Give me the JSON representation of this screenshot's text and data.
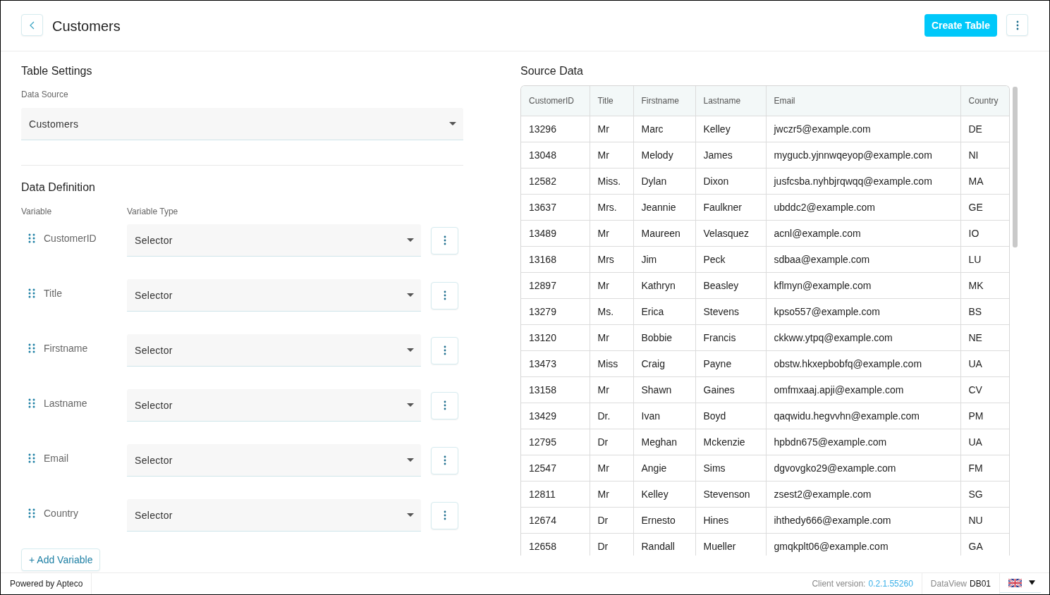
{
  "header": {
    "title": "Customers",
    "primary_action": "Create Table"
  },
  "table_settings": {
    "title": "Table Settings",
    "data_source": {
      "label": "Data Source",
      "value": "Customers"
    }
  },
  "data_definition": {
    "title": "Data Definition",
    "columns": [
      "Variable",
      "Variable Type"
    ],
    "variables": [
      {
        "name": "CustomerID",
        "type": "Selector"
      },
      {
        "name": "Title",
        "type": "Selector"
      },
      {
        "name": "Firstname",
        "type": "Selector"
      },
      {
        "name": "Lastname",
        "type": "Selector"
      },
      {
        "name": "Email",
        "type": "Selector"
      },
      {
        "name": "Country",
        "type": "Selector"
      }
    ],
    "add_button": "+ Add Variable"
  },
  "source_data": {
    "title": "Source Data",
    "columns": [
      "CustomerID",
      "Title",
      "Firstname",
      "Lastname",
      "Email",
      "Country"
    ],
    "rows": [
      [
        "13296",
        "Mr",
        "Marc",
        "Kelley",
        "jwczr5@example.com",
        "DE"
      ],
      [
        "13048",
        "Mr",
        "Melody",
        "James",
        "mygucb.yjnnwqeyop@example.com",
        "NI"
      ],
      [
        "12582",
        "Miss.",
        "Dylan",
        "Dixon",
        "jusfcsba.nyhbjrqwqq@example.com",
        "MA"
      ],
      [
        "13637",
        "Mrs.",
        "Jeannie",
        "Faulkner",
        "ubddc2@example.com",
        "GE"
      ],
      [
        "13489",
        "Mr",
        "Maureen",
        "Velasquez",
        "acnl@example.com",
        "IO"
      ],
      [
        "13168",
        "Mrs",
        "Jim",
        "Peck",
        "sdbaa@example.com",
        "LU"
      ],
      [
        "12897",
        "Mr",
        "Kathryn",
        "Beasley",
        "kflmyn@example.com",
        "MK"
      ],
      [
        "13279",
        "Ms.",
        "Erica",
        "Stevens",
        "kpso557@example.com",
        "BS"
      ],
      [
        "13120",
        "Mr",
        "Bobbie",
        "Francis",
        "ckkww.ytpq@example.com",
        "NE"
      ],
      [
        "13473",
        "Miss",
        "Craig",
        "Payne",
        "obstw.hkxepbobfq@example.com",
        "UA"
      ],
      [
        "13158",
        "Mr",
        "Shawn",
        "Gaines",
        "omfmxaaj.apji@example.com",
        "CV"
      ],
      [
        "13429",
        "Dr.",
        "Ivan",
        "Boyd",
        "qaqwidu.hegvvhn@example.com",
        "PM"
      ],
      [
        "12795",
        "Dr",
        "Meghan",
        "Mckenzie",
        "hpbdn675@example.com",
        "UA"
      ],
      [
        "12547",
        "Mr",
        "Angie",
        "Sims",
        "dgvovgko29@example.com",
        "FM"
      ],
      [
        "12811",
        "Mr",
        "Kelley",
        "Stevenson",
        "zsest2@example.com",
        "SG"
      ],
      [
        "12674",
        "Dr",
        "Ernesto",
        "Hines",
        "ihthedy666@example.com",
        "NU"
      ],
      [
        "12658",
        "Dr",
        "Randall",
        "Mueller",
        "gmqkplt06@example.com",
        "GA"
      ]
    ]
  },
  "footer": {
    "powered_by": "Powered by Apteco",
    "client_version": {
      "label": "Client version:",
      "value": "0.2.1.55260"
    },
    "dataview": {
      "label": "DataView",
      "value": "DB01"
    }
  }
}
